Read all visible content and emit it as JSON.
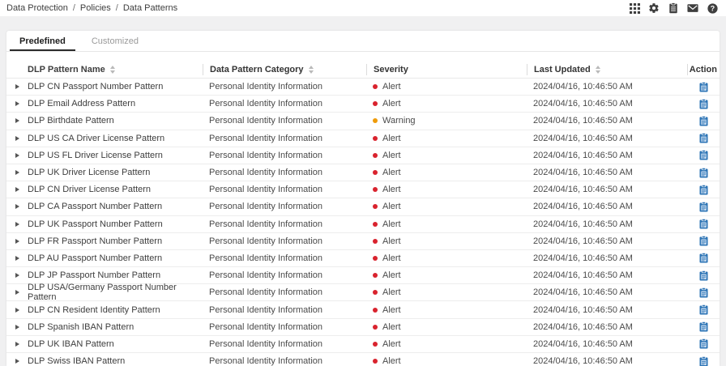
{
  "breadcrumb": {
    "separator": "/",
    "items": [
      "Data Protection",
      "Policies",
      "Data Patterns"
    ]
  },
  "topbar": {
    "icons": [
      "apps-grid-icon",
      "settings-gear-icon",
      "clipboard-icon",
      "mail-icon",
      "help-icon"
    ]
  },
  "tabs": [
    {
      "label": "Predefined",
      "active": true
    },
    {
      "label": "Customized",
      "active": false
    }
  ],
  "table": {
    "columns": [
      {
        "label": "DLP Pattern Name",
        "sortable": true
      },
      {
        "label": "Data Pattern Category",
        "sortable": true
      },
      {
        "label": "Severity",
        "sortable": false
      },
      {
        "label": "Last Updated",
        "sortable": true
      },
      {
        "label": "Action",
        "sortable": false
      }
    ],
    "rows": [
      {
        "name": "DLP CN Passport Number Pattern",
        "category": "Personal Identity Information",
        "severity": "Alert",
        "last_updated": "2024/04/16, 10:46:50 AM"
      },
      {
        "name": "DLP Email Address Pattern",
        "category": "Personal Identity Information",
        "severity": "Alert",
        "last_updated": "2024/04/16, 10:46:50 AM"
      },
      {
        "name": "DLP Birthdate Pattern",
        "category": "Personal Identity Information",
        "severity": "Warning",
        "last_updated": "2024/04/16, 10:46:50 AM"
      },
      {
        "name": "DLP US CA Driver License Pattern",
        "category": "Personal Identity Information",
        "severity": "Alert",
        "last_updated": "2024/04/16, 10:46:50 AM"
      },
      {
        "name": "DLP US FL Driver License Pattern",
        "category": "Personal Identity Information",
        "severity": "Alert",
        "last_updated": "2024/04/16, 10:46:50 AM"
      },
      {
        "name": "DLP UK Driver License Pattern",
        "category": "Personal Identity Information",
        "severity": "Alert",
        "last_updated": "2024/04/16, 10:46:50 AM"
      },
      {
        "name": "DLP CN Driver License Pattern",
        "category": "Personal Identity Information",
        "severity": "Alert",
        "last_updated": "2024/04/16, 10:46:50 AM"
      },
      {
        "name": "DLP CA Passport Number Pattern",
        "category": "Personal Identity Information",
        "severity": "Alert",
        "last_updated": "2024/04/16, 10:46:50 AM"
      },
      {
        "name": "DLP UK Passport Number Pattern",
        "category": "Personal Identity Information",
        "severity": "Alert",
        "last_updated": "2024/04/16, 10:46:50 AM"
      },
      {
        "name": "DLP FR Passport Number Pattern",
        "category": "Personal Identity Information",
        "severity": "Alert",
        "last_updated": "2024/04/16, 10:46:50 AM"
      },
      {
        "name": "DLP AU Passport Number Pattern",
        "category": "Personal Identity Information",
        "severity": "Alert",
        "last_updated": "2024/04/16, 10:46:50 AM"
      },
      {
        "name": "DLP JP Passport Number Pattern",
        "category": "Personal Identity Information",
        "severity": "Alert",
        "last_updated": "2024/04/16, 10:46:50 AM"
      },
      {
        "name": "DLP USA/Germany Passport Number Pattern",
        "category": "Personal Identity Information",
        "severity": "Alert",
        "last_updated": "2024/04/16, 10:46:50 AM"
      },
      {
        "name": "DLP CN Resident Identity Pattern",
        "category": "Personal Identity Information",
        "severity": "Alert",
        "last_updated": "2024/04/16, 10:46:50 AM"
      },
      {
        "name": "DLP Spanish IBAN Pattern",
        "category": "Personal Identity Information",
        "severity": "Alert",
        "last_updated": "2024/04/16, 10:46:50 AM"
      },
      {
        "name": "DLP UK IBAN Pattern",
        "category": "Personal Identity Information",
        "severity": "Alert",
        "last_updated": "2024/04/16, 10:46:50 AM"
      },
      {
        "name": "DLP Swiss IBAN Pattern",
        "category": "Personal Identity Information",
        "severity": "Alert",
        "last_updated": "2024/04/16, 10:46:50 AM"
      }
    ]
  },
  "colors": {
    "alert": "#d9232e",
    "warning": "#ef9b0a",
    "action_icon": "#2e75b6",
    "topbar_icon": "#3f3f3f"
  }
}
